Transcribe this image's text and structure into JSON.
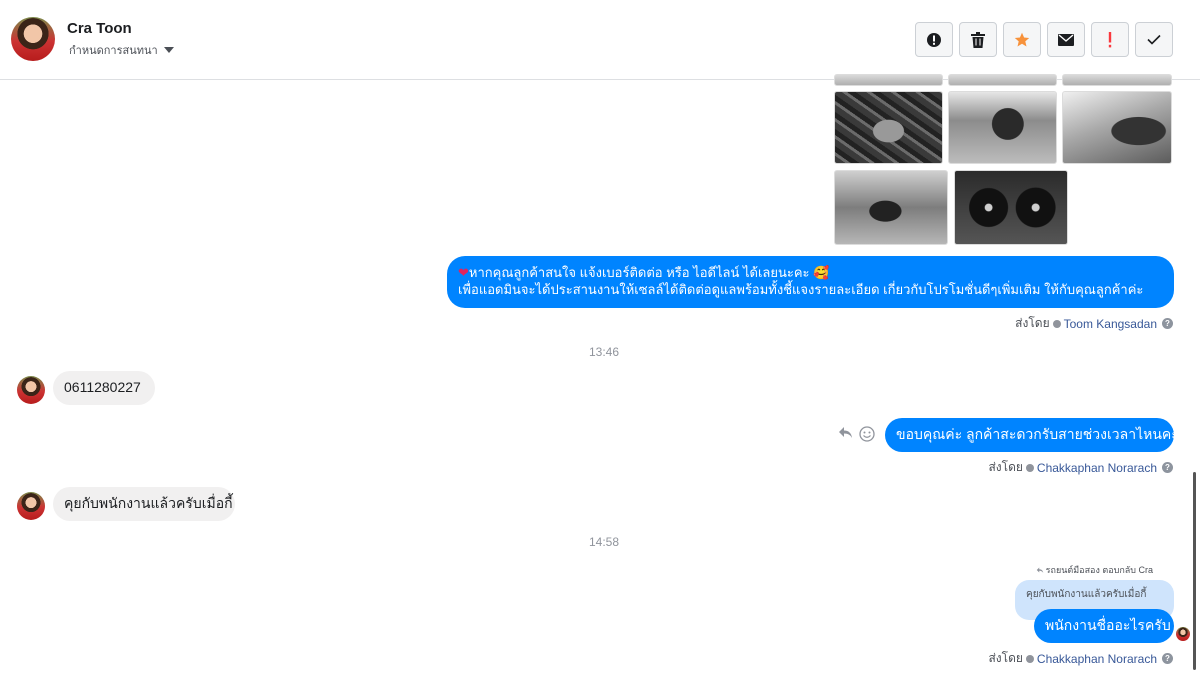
{
  "header": {
    "contact_name": "Cra Toon",
    "subtitle": "กำหนดการสนทนา",
    "actions": [
      {
        "name": "report-button",
        "icon": "alert-circle-icon"
      },
      {
        "name": "delete-button",
        "icon": "trash-icon"
      },
      {
        "name": "star-button",
        "icon": "star-icon"
      },
      {
        "name": "mark-unread-button",
        "icon": "envelope-icon"
      },
      {
        "name": "mark-important-button",
        "icon": "exclamation-icon"
      },
      {
        "name": "mark-done-button",
        "icon": "checkmark-icon"
      }
    ]
  },
  "colors": {
    "accent": "#0084ff",
    "star": "#f7923b",
    "important": "#fa383e",
    "incoming_bubble": "#f1f0f0",
    "agent_link": "#385898"
  },
  "messages": {
    "promo_line1": "หากคุณลูกค้าสนใจ แจ้งเบอร์ติดต่อ หรือ ไอดีไลน์ ได้เลยนะคะ",
    "promo_line2": "เพื่อแอดมินจะได้ประสานงานให้เซลล์ได้ติดต่อดูแลพร้อมทั้งชี้แจงรายละเอียด เกี่ยวกับโปรโมชั่นดีๆเพิ่มเติม ให้กับคุณลูกค้าค่ะ",
    "promo_sender_prefix": "ส่งโดย",
    "promo_sender": "Toom Kangsadan",
    "time1": "13:46",
    "phone": "0611280227",
    "thanks": "ขอบคุณค่ะ ลูกค้าสะดวกรับสายช่วงเวลาไหนคะ",
    "thanks_sender_prefix": "ส่งโดย",
    "thanks_sender": "Chakkaphan Norarach",
    "customer_reply": "คุยกับพนักงานแล้วครับเมื่อกี้",
    "time2": "14:58",
    "reply_context": "รถยนต์มือสอง ตอบกลับ Cra",
    "quoted": "คุยกับพนักงานแล้วครับเมื่อกี้",
    "last": "พนักงานชื่ออะไรครับ",
    "last_sender_prefix": "ส่งโดย",
    "last_sender": "Chakkaphan Norarach"
  }
}
